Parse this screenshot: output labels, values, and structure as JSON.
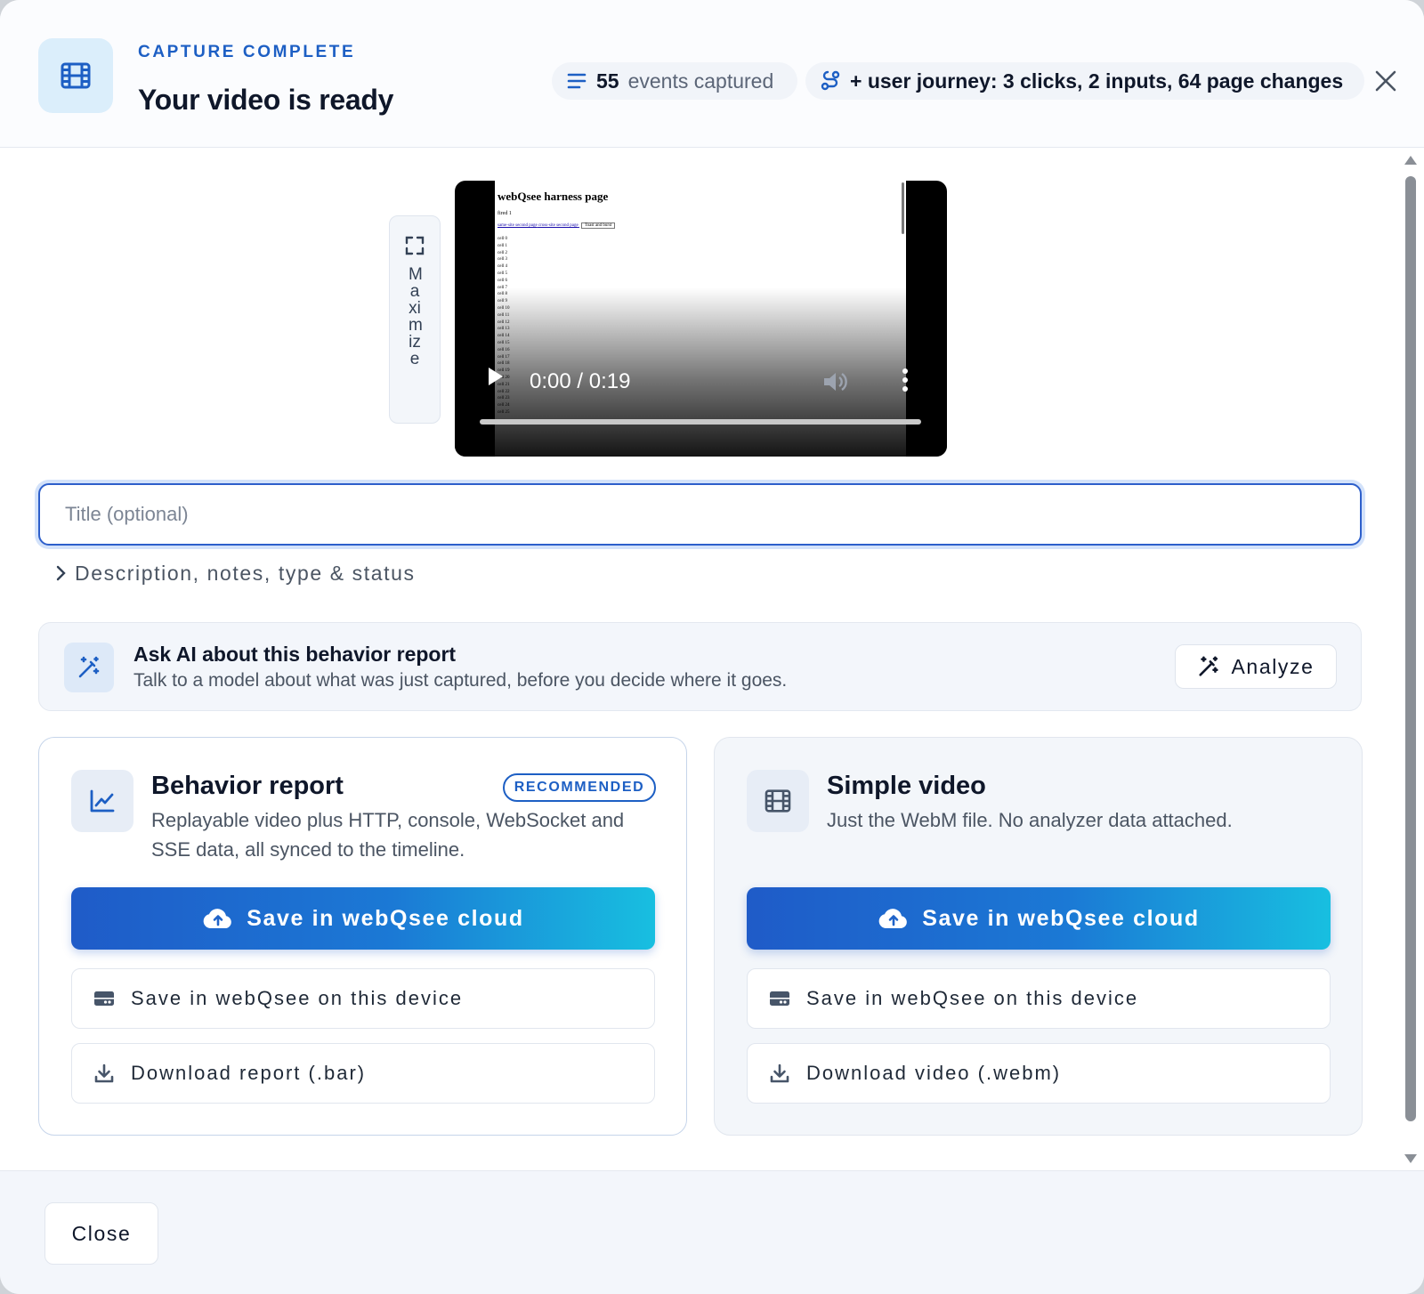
{
  "header": {
    "eyebrow": "CAPTURE COMPLETE",
    "title": "Your video is ready",
    "events_count": "55",
    "events_label": "events captured",
    "journey_text": "+ user journey: 3 clicks, 2 inputs, 64 page changes",
    "icons": {
      "main": "film-icon",
      "events": "list-icon",
      "journey": "route-icon",
      "close": "close-icon"
    }
  },
  "video": {
    "maximize_label": "Maximize",
    "time": "0:00 / 0:19",
    "progress": 0,
    "page": {
      "title": "webQsee harness page",
      "fired": "fired 1",
      "link_1": "same-site second page",
      "link_2": "cross-site second page",
      "button": "Toast and burst",
      "cells": [
        "cell 0",
        "cell 1",
        "cell 2",
        "cell 3",
        "cell 4",
        "cell 5",
        "cell 6",
        "cell 7",
        "cell 8",
        "cell 9",
        "cell 10",
        "cell 11",
        "cell 12",
        "cell 13",
        "cell 14",
        "cell 15",
        "cell 16",
        "cell 17",
        "cell 18",
        "cell 19",
        "cell 20",
        "cell 21",
        "cell 22",
        "cell 23",
        "cell 24",
        "cell 25"
      ]
    }
  },
  "form": {
    "title_placeholder": "Title (optional)",
    "title_value": "",
    "details_toggle": "Description, notes, type & status"
  },
  "ai": {
    "title": "Ask AI about this behavior report",
    "subtitle": "Talk to a model about what was just captured, before you decide where it goes.",
    "analyze_label": "Analyze"
  },
  "cards": {
    "behavior": {
      "title": "Behavior report",
      "badge": "RECOMMENDED",
      "description": "Replayable video plus HTTP, console, WebSocket and SSE data, all synced to the timeline.",
      "primary": "Save in webQsee cloud",
      "device": "Save in webQsee on this device",
      "download": "Download report (.bar)"
    },
    "simple": {
      "title": "Simple video",
      "description": "Just the WebM file. No analyzer data attached.",
      "primary": "Save in webQsee cloud",
      "device": "Save in webQsee on this device",
      "download": "Download video (.webm)"
    }
  },
  "footer": {
    "close_label": "Close"
  },
  "colors": {
    "accent": "#1d5fc4",
    "gradient_start": "#1f5bc8",
    "gradient_end": "#18bfe0"
  }
}
